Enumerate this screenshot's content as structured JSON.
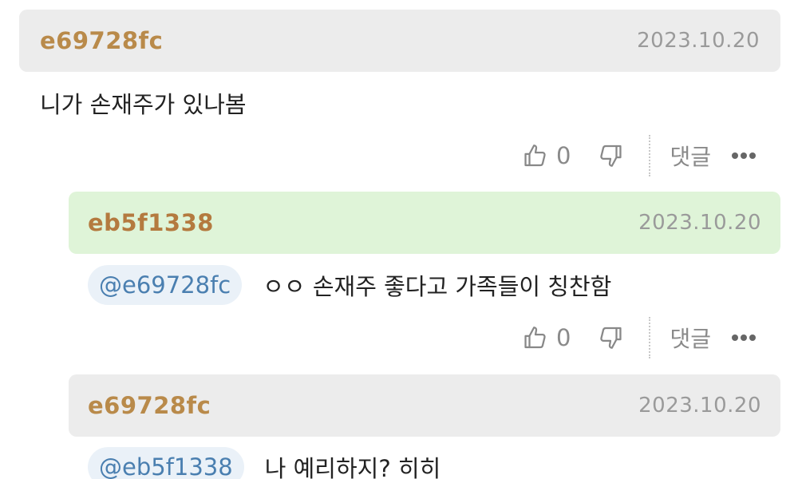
{
  "comments": [
    {
      "author": "e69728fc",
      "date": "2023.10.20",
      "mention": "",
      "text": "니가 손재주가 있나봄",
      "likes": "0",
      "reply_label": "댓글",
      "header_color": "#ececec"
    },
    {
      "author": "eb5f1338",
      "date": "2023.10.20",
      "mention": "@e69728fc",
      "text": "ㅇㅇ 손재주 좋다고 가족들이 칭찬함",
      "likes": "0",
      "reply_label": "댓글",
      "header_color": "#dff4d8"
    },
    {
      "author": "e69728fc",
      "date": "2023.10.20",
      "mention": "@eb5f1338",
      "text": "나 예리하지? 히히",
      "header_color": "#ececec"
    }
  ],
  "colors": {
    "author": "#b98a4a",
    "date": "#9a9a9a",
    "mention_bg": "#eaf1f8",
    "mention_text": "#4a7fb0",
    "body_text": "#222222",
    "action_gray": "#8a8a8a"
  },
  "icons": {
    "like": "thumbs-up-icon",
    "dislike": "thumbs-down-icon",
    "more": "more-dots-icon"
  }
}
